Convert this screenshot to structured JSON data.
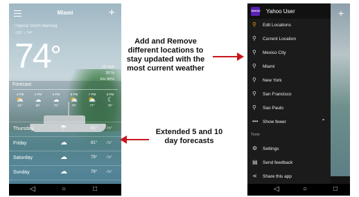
{
  "left_phone": {
    "city": "Miami",
    "location_line": "Tropical Storm Warning",
    "hi_lo_line": "↑ 81°  ↓ 74°",
    "temperature": "74",
    "degree_symbol": "°",
    "right_block": [
      "10 mph",
      "30 %",
      "RH 86%"
    ],
    "forecast_label": "Forecast",
    "hourly": [
      {
        "time": "3 PM",
        "icon": "cloud-sun-icon",
        "glyph": "⛅",
        "temp": "81°"
      },
      {
        "time": "4 PM",
        "icon": "cloud-icon",
        "glyph": "☁",
        "temp": "80°"
      },
      {
        "time": "5 PM",
        "icon": "cloud-icon",
        "glyph": "☁",
        "temp": "79°"
      },
      {
        "time": "6 PM",
        "icon": "cloud-sun-icon",
        "glyph": "⛅",
        "temp": "78°"
      },
      {
        "time": "7 PM",
        "icon": "cloud-sun-icon",
        "glyph": "⛅",
        "temp": "77°"
      },
      {
        "time": "8 PM",
        "icon": "moon-icon",
        "glyph": "☾",
        "temp": "76°"
      }
    ],
    "days": [
      {
        "name": "Thursday",
        "icon": "cloud-rain-icon",
        "glyph": "☂",
        "hi": "81°",
        "lo": "75°"
      },
      {
        "name": "Friday",
        "icon": "cloud-icon",
        "glyph": "☁",
        "hi": "81°",
        "lo": "75°"
      },
      {
        "name": "Saturday",
        "icon": "cloud-icon",
        "glyph": "☁",
        "hi": "79°",
        "lo": "75°"
      },
      {
        "name": "Sunday",
        "icon": "cloud-icon",
        "glyph": "☁",
        "hi": "79°",
        "lo": "75°"
      },
      {
        "name": "Monday",
        "icon": "cloud-icon",
        "glyph": "☁",
        "hi": "79°",
        "lo": "75°"
      }
    ]
  },
  "callouts": {
    "top": "Add and Remove different locations to stay updated with the most current weather",
    "bottom": "Extended 5 and 10 day forecasts"
  },
  "right_phone": {
    "app_icon_text": "YAHOO!",
    "user_name": "Yahoo User",
    "menu": [
      {
        "label": "Edit Locations",
        "icon": "pin-icon",
        "glyph": "⚲"
      },
      {
        "label": "Current Location",
        "icon": "pin-icon",
        "glyph": "⚲"
      },
      {
        "label": "Mexico City",
        "icon": "pin-icon",
        "glyph": "⚲"
      },
      {
        "label": "Miami",
        "icon": "pin-icon",
        "glyph": "⚲"
      },
      {
        "label": "New York",
        "icon": "pin-icon",
        "glyph": "⚲"
      },
      {
        "label": "San Francisco",
        "icon": "pin-icon",
        "glyph": "⚲"
      },
      {
        "label": "Sao Paulo",
        "icon": "pin-icon",
        "glyph": "⚲"
      },
      {
        "label": "Show fewer",
        "icon": "more-icon",
        "glyph": "•••"
      }
    ],
    "tools_label": "Tools",
    "tools": [
      {
        "label": "Settings",
        "icon": "gear-icon",
        "glyph": "⚙"
      },
      {
        "label": "Send feedback",
        "icon": "feedback-icon",
        "glyph": "▤"
      },
      {
        "label": "Share this app",
        "icon": "share-icon",
        "glyph": "⋖"
      }
    ]
  },
  "nav": {
    "back": "◁",
    "home": "○",
    "recent": "□"
  },
  "colors": {
    "arrow": "#c8161d",
    "accent_purple": "#5b21b6",
    "pin_orange": "#f4a300"
  }
}
